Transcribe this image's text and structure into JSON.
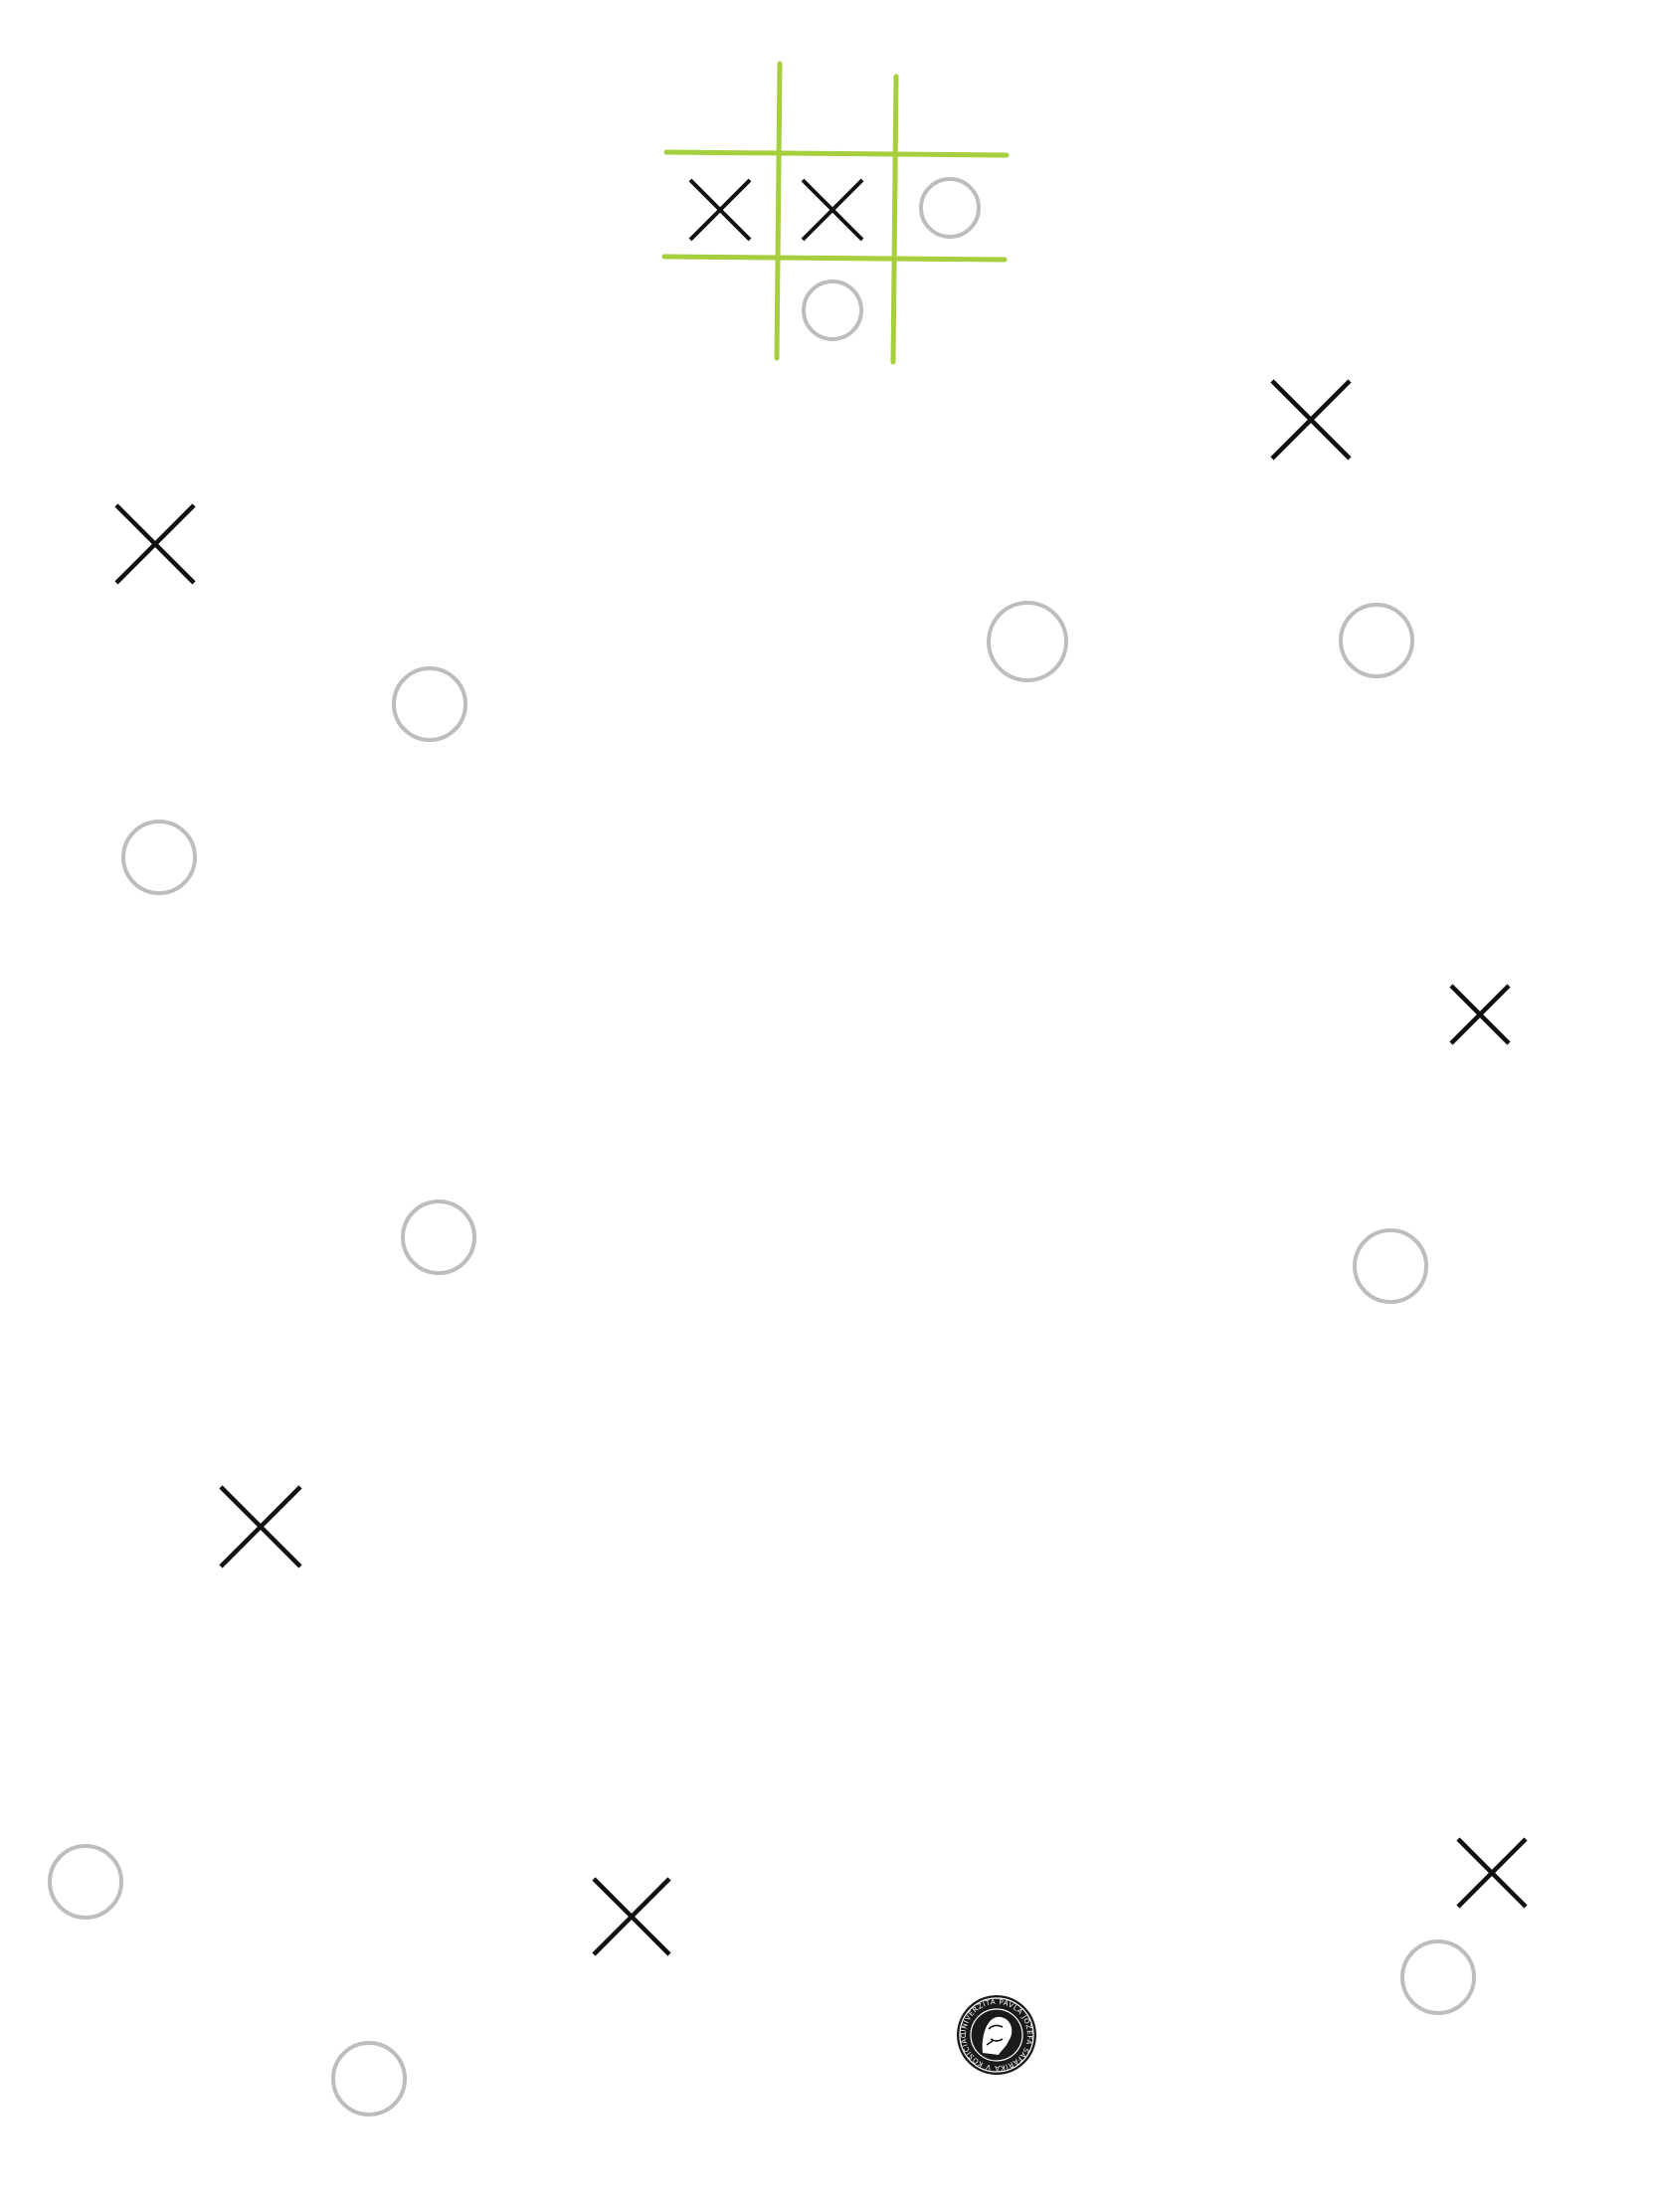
{
  "game": {
    "type": "tic-tac-toe",
    "board": {
      "cells": [
        [
          "X",
          "X",
          "O"
        ],
        [
          "",
          "O",
          ""
        ],
        [
          "",
          "",
          ""
        ]
      ]
    },
    "scattered_marks": [
      "X",
      "X",
      "O",
      "O",
      "O",
      "O",
      "X",
      "O",
      "O",
      "X",
      "O",
      "X",
      "X",
      "O",
      "O"
    ],
    "logo": {
      "kind": "circular-seal",
      "text": "UNIVERZITA PAVLA JOZEFA ŠAFÁRIKA V KOŠICIACH"
    }
  },
  "colors": {
    "background": "#ffffff",
    "grid": "#a6cf3e",
    "x_mark": "#111111",
    "o_mark": "#bdbdbd",
    "seal_dark": "#1a1a1a",
    "seal_light": "#ffffff"
  }
}
